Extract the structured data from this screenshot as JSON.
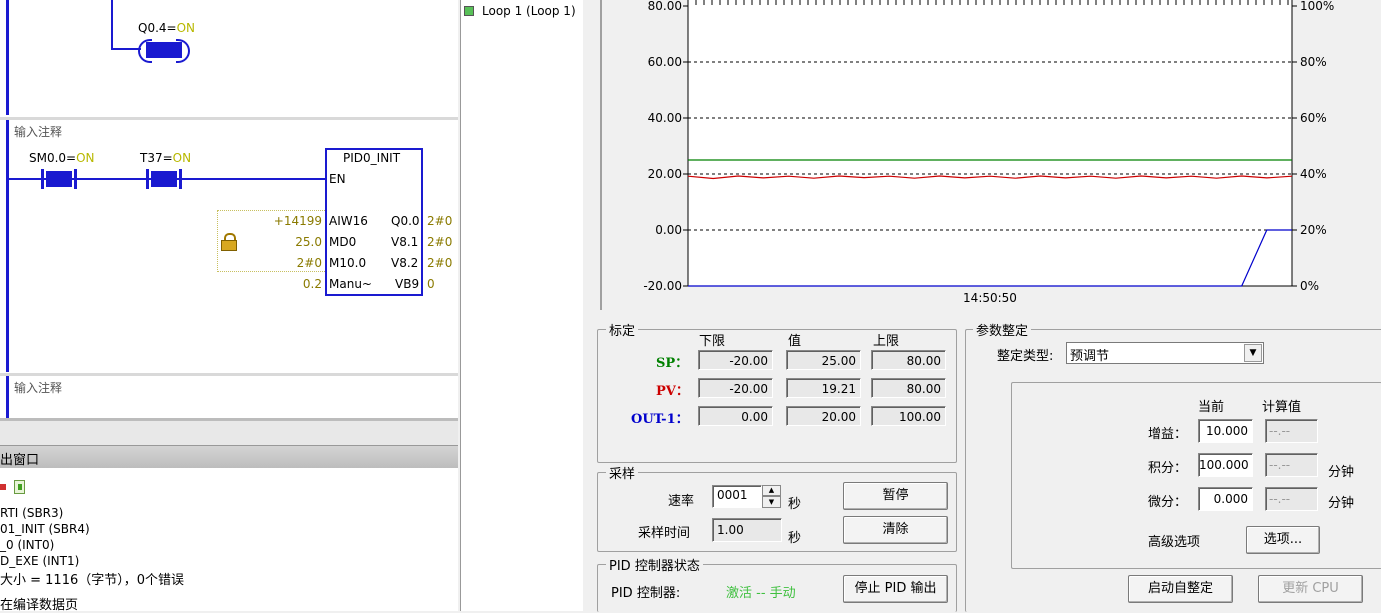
{
  "ladder": {
    "coil1_label": "Q0.4=",
    "on": "ON",
    "comment": "输入注释",
    "contact1_label": "SM0.0=",
    "contact2_label": "T37=",
    "pid_title": "PID0_INIT",
    "en": "EN",
    "inputs": [
      {
        "val": "+14199",
        "pin": "AIW16"
      },
      {
        "val": "25.0",
        "pin": "MD0"
      },
      {
        "val": "2#0",
        "pin": "M10.0"
      },
      {
        "val": "0.2",
        "pin": "Manu~"
      }
    ],
    "outputs": [
      {
        "pin": "Q0.0",
        "val": "2#0"
      },
      {
        "pin": "V8.1",
        "val": "2#0"
      },
      {
        "pin": "V8.2",
        "val": "2#0"
      },
      {
        "pin": "VB9",
        "val": "0"
      }
    ],
    "comment2": "输入注释"
  },
  "output_window": {
    "title": "出窗口",
    "lines": [
      "RTI (SBR3)",
      "01_INIT (SBR4)",
      "_0 (INT0)",
      "D_EXE (INT1)",
      "大小 = 1116（字节），0个错误",
      "在编译数据页"
    ]
  },
  "tree": {
    "item": "Loop 1 (Loop 1)"
  },
  "chart_data": {
    "type": "line",
    "y_left_ticks": [
      "80.00",
      "60.00",
      "40.00",
      "20.00",
      "0.00",
      "-20.00"
    ],
    "y_right_ticks": [
      "100%",
      "80%",
      "60%",
      "40%",
      "20%",
      "0%"
    ],
    "ylim": [
      -20,
      80
    ],
    "x_label": "14:50:50",
    "series": [
      {
        "color": "#008000",
        "values": [
          25,
          25
        ]
      },
      {
        "color": "#cc0000",
        "values": [
          19.2,
          18.4,
          19.3,
          18.6,
          19.2,
          18.5,
          19.3,
          18.7,
          19.2,
          18.5,
          19.3,
          18.6,
          19.2,
          18.5,
          19.3,
          18.6,
          19.2,
          18.5,
          19.3,
          18.6,
          19.2,
          18.5,
          19.3,
          18.6,
          19.2
        ]
      },
      {
        "color": "#0000cc",
        "values": [
          -20,
          -20,
          -20,
          -20,
          -20,
          -20,
          -20,
          -20,
          -20,
          -20,
          -20,
          -20,
          -20,
          -20,
          -20,
          -20,
          -20,
          -20,
          -20,
          -20,
          -20,
          -20,
          -20,
          0,
          0
        ]
      }
    ]
  },
  "calib": {
    "title": "标定",
    "headers": [
      "下限",
      "值",
      "上限"
    ],
    "rows": [
      {
        "label": "SP：",
        "color": "#008000",
        "low": "-20.00",
        "val": "25.00",
        "high": "80.00"
      },
      {
        "label": "PV：",
        "color": "#cc0000",
        "low": "-20.00",
        "val": "19.21",
        "high": "80.00"
      },
      {
        "label": "OUT-1：",
        "color": "#0000cc",
        "low": "0.00",
        "val": "20.00",
        "high": "100.00"
      }
    ]
  },
  "sampling": {
    "title": "采样",
    "rate_label": "速率",
    "rate_value": "0001",
    "rate_unit": "秒",
    "time_label": "采样时间",
    "time_value": "1.00",
    "time_unit": "秒",
    "pause": "暂停",
    "clear": "清除"
  },
  "status": {
    "title": "PID 控制器状态",
    "label": "PID 控制器:",
    "value": "激活 -- 手动",
    "stop_btn": "停止 PID 输出"
  },
  "tuning": {
    "title": "参数整定",
    "type_label": "整定类型:",
    "type_value": "预调节",
    "col_current": "当前",
    "col_calc": "计算值",
    "gain_label": "增益：",
    "gain_val": "10.000",
    "gain_calc": "--.--",
    "int_label": "积分：",
    "int_val": "100.000",
    "int_calc": "--.--",
    "int_unit": "分钟",
    "der_label": "微分：",
    "der_val": "0.000",
    "der_calc": "--.--",
    "der_unit": "分钟",
    "adv_label": "高级选项",
    "options_btn": "选项...",
    "start_btn": "启动自整定",
    "update_btn": "更新 CPU"
  }
}
